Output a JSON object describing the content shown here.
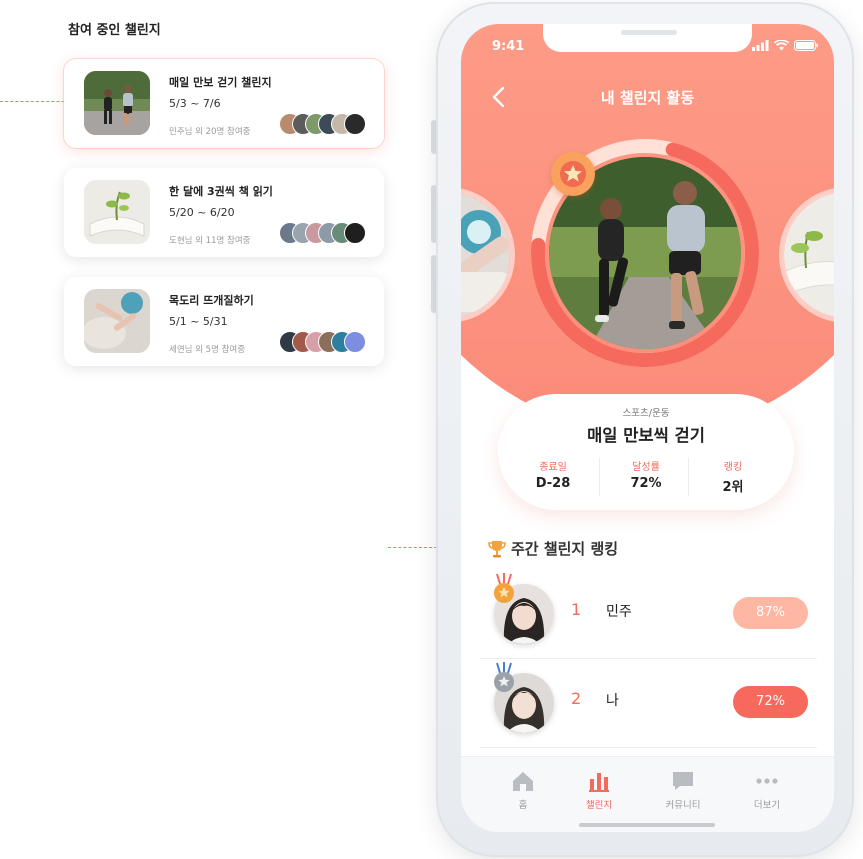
{
  "left_panel": {
    "title": "참여 중인 챌린지",
    "cards": [
      {
        "title": "매일 만보 걷기 챌린지",
        "date": "5/3 ~ 7/6",
        "meta": "민주님 외 20명 참여중"
      },
      {
        "title": "한 달에 3권씩 책 읽기",
        "date": "5/20 ~ 6/20",
        "meta": "도현님 외 11명 참여중"
      },
      {
        "title": "목도리 뜨개질하기",
        "date": "5/1 ~ 5/31",
        "meta": "세연님 외 5명 참여중"
      }
    ]
  },
  "status_bar": {
    "time": "9:41"
  },
  "header": {
    "title": "내 챌린지 활동"
  },
  "challenge": {
    "category": "스포츠/운동",
    "title": "매일 만보씩 걷기",
    "progress": 0.72,
    "stats": [
      {
        "label": "종료일",
        "value": "D-28"
      },
      {
        "label": "달성률",
        "value": "72%"
      },
      {
        "label": "랭킹",
        "value": "2위"
      }
    ]
  },
  "ranking": {
    "title": "주간 챌린지 랭킹",
    "rows": [
      {
        "rank": "1",
        "name": "민주",
        "percent": "87%",
        "color": "#fdb7a3"
      },
      {
        "rank": "2",
        "name": "나",
        "percent": "72%",
        "color": "#f7695c"
      }
    ]
  },
  "tabbar": {
    "items": [
      {
        "label": "홈",
        "icon": "home-icon",
        "active": false
      },
      {
        "label": "챌린지",
        "icon": "bar-chart-icon",
        "active": true
      },
      {
        "label": "커뮤니티",
        "icon": "chat-bubble-icon",
        "active": false
      },
      {
        "label": "더보기",
        "icon": "more-dots-icon",
        "active": false
      }
    ]
  },
  "colors": {
    "accent": "#f26b5c",
    "hero_top": "#ffb49c",
    "hero_bottom": "#fc8b7a",
    "badge": "#f9a15d"
  }
}
